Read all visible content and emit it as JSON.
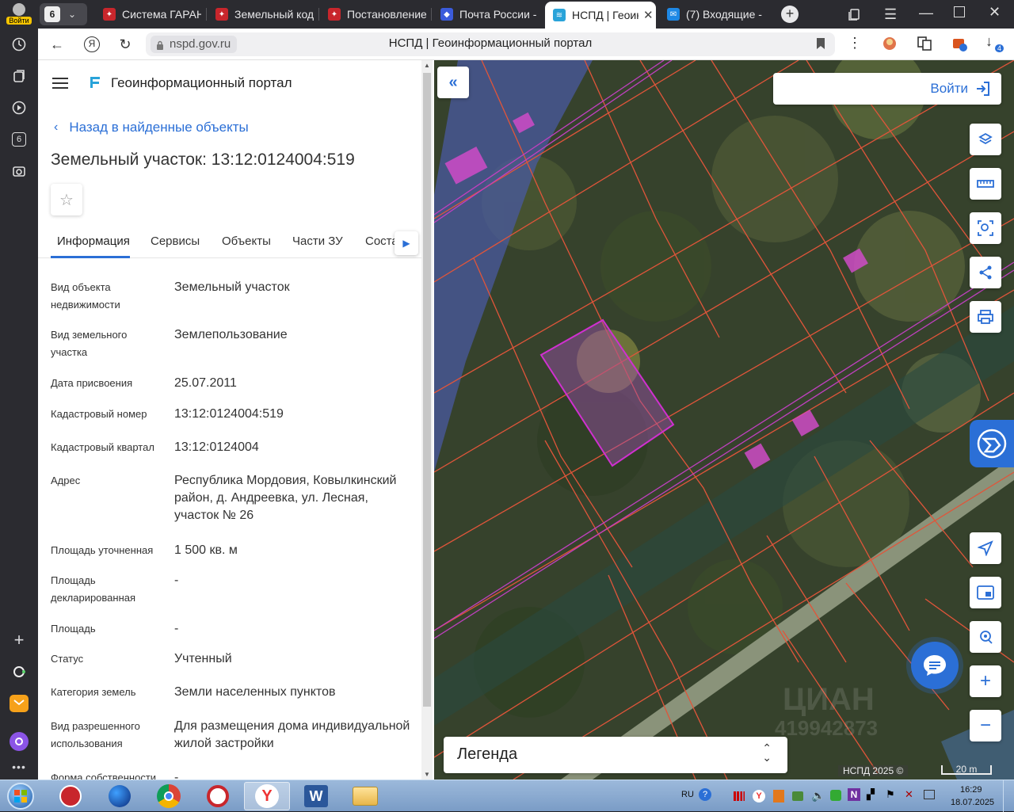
{
  "browser": {
    "login_label": "Войти",
    "tab_counter": "6",
    "tabs": [
      {
        "label": "Система ГАРАНТ",
        "favicon_color": "#c8262c"
      },
      {
        "label": "Земельный кодекс",
        "favicon_color": "#c8262c"
      },
      {
        "label": "Постановление",
        "favicon_color": "#c8262c"
      },
      {
        "label": "Почта России - ",
        "favicon_color": "#3b5bdb"
      },
      {
        "label": "НСПД | Геоинформационный портал",
        "favicon_color": "#29a3d9",
        "active": true
      },
      {
        "label": "(7) Входящие - ",
        "favicon_color": "#1e88e5"
      }
    ],
    "url": "nspd.gov.ru",
    "page_title": "НСПД | Геоинформационный портал",
    "download_badge": "4",
    "sidebar_badge": "6"
  },
  "portal": {
    "app_title": "Геоинформационный портал",
    "back_link": "Назад в найденные объекты",
    "object_title": "Земельный участок: 13:12:0124004:519",
    "tabs": [
      "Информация",
      "Сервисы",
      "Объекты",
      "Части ЗУ",
      "Состав"
    ],
    "properties": [
      {
        "label": "Вид объекта недвижимости",
        "value": "Земельный участок"
      },
      {
        "label": "Вид земельного участка",
        "value": "Землепользование"
      },
      {
        "label": "Дата присвоения",
        "value": "25.07.2011"
      },
      {
        "label": "Кадастровый номер",
        "value": "13:12:0124004:519"
      },
      {
        "label": "Кадастровый квартал",
        "value": "13:12:0124004"
      },
      {
        "label": "Адрес",
        "value": "Республика Мордовия, Ковылкинский район, д. Андреевка, ул. Лесная, участок № 26"
      },
      {
        "label": "Площадь уточненная",
        "value": "1 500 кв. м"
      },
      {
        "label": "Площадь декларированная",
        "value": "-"
      },
      {
        "label": "Площадь",
        "value": "-"
      },
      {
        "label": "Статус",
        "value": "Учтенный"
      },
      {
        "label": "Категория земель",
        "value": "Земли населенных пунктов"
      },
      {
        "label": "Вид разрешенного использования",
        "value": "Для размещения дома индивидуальной жилой застройки"
      },
      {
        "label": "Форма собственности",
        "value": "-"
      }
    ]
  },
  "map": {
    "login": "Войти",
    "legend": "Легенда",
    "copyright": "НСПД 2025 ©",
    "scale": "20 m",
    "watermark": "ЦИАН 419942873",
    "colors": {
      "parcel_border": "#e0553a",
      "selected_parcel": "#d030d0",
      "accent": "#2b6fd6"
    }
  },
  "taskbar": {
    "lang": "RU",
    "time": "16:29",
    "date": "18.07.2025"
  }
}
